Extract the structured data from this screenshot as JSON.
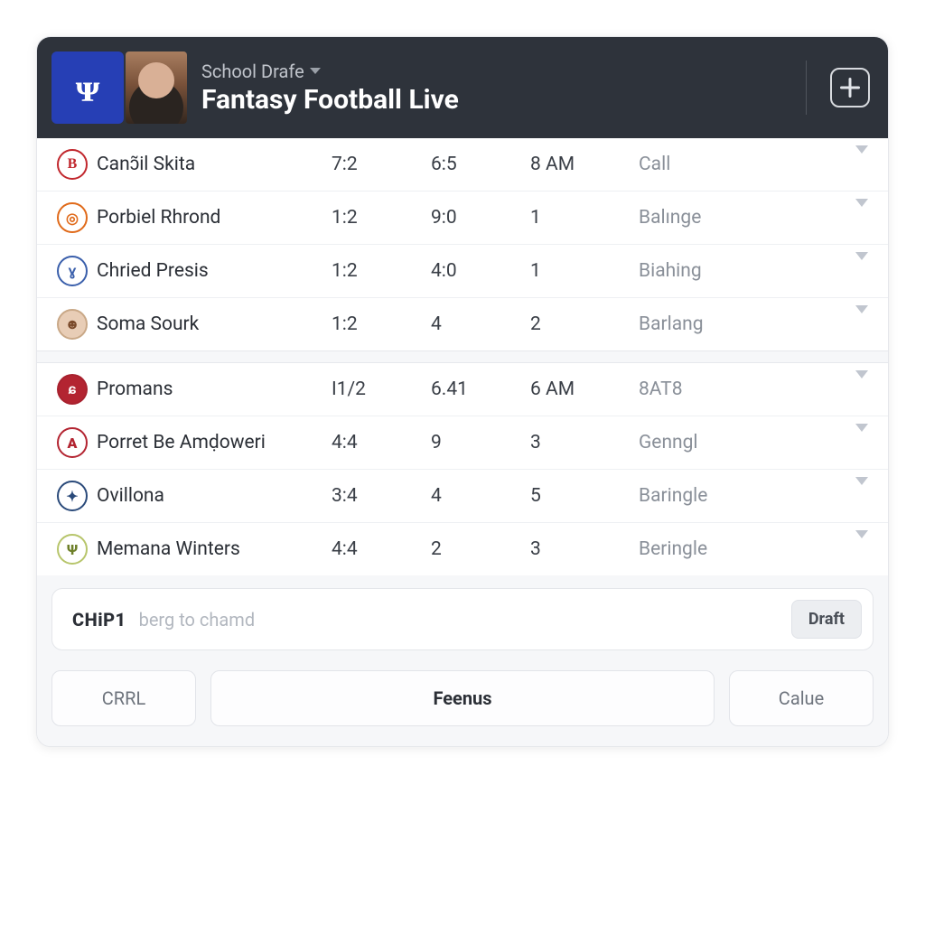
{
  "header": {
    "logo_letter": "ᴪ",
    "subtitle": "School Drafe",
    "title": "Fantasy Football Live"
  },
  "group1": [
    {
      "badge_class": "b-red",
      "badge_text": "B",
      "name": "Canɔ̃il Skita",
      "c2": "7:2",
      "c3": "6:5",
      "c4": "8 AM",
      "status": "Call"
    },
    {
      "badge_class": "b-orange",
      "badge_text": "◎",
      "name": "Porbiel Rhrond",
      "c2": "1:2",
      "c3": "9:0",
      "c4": "1",
      "status": "Balınge"
    },
    {
      "badge_class": "b-bird",
      "badge_text": "ɣ",
      "name": "Chried Presis",
      "c2": "1:2",
      "c3": "4:0",
      "c4": "1",
      "status": "Biahing"
    },
    {
      "badge_class": "b-face",
      "badge_text": "☻",
      "name": "Soma Sourk",
      "c2": "1:2",
      "c3": "4",
      "c4": "2",
      "status": "Barlang"
    }
  ],
  "group2": [
    {
      "badge_class": "b-crim",
      "badge_text": "ɕ",
      "name": "Promans",
      "c2": "I1/2",
      "c3": "6.41",
      "c4": "6 AM",
      "status": "8AT8"
    },
    {
      "badge_class": "b-angel",
      "badge_text": "A",
      "name": "Porret Be Amḍoweri",
      "c2": "4:4",
      "c3": "9",
      "c4": "3",
      "status": "Genngl"
    },
    {
      "badge_class": "b-star",
      "badge_text": "✦",
      "name": "Ovillona",
      "c2": "3:4",
      "c3": "4",
      "c4": "5",
      "status": "Baringle"
    },
    {
      "badge_class": "b-shield",
      "badge_text": "Ѱ",
      "name": "Memana Winters",
      "c2": "4:4",
      "c3": "2",
      "c4": "3",
      "status": "Beringle"
    }
  ],
  "footer": {
    "input_prefix": "CHiP1",
    "input_placeholder": "berg to chamd",
    "draft_button": "Draft",
    "left_button": "CRRL",
    "center_button": "Feenus",
    "right_button": "Calue"
  }
}
